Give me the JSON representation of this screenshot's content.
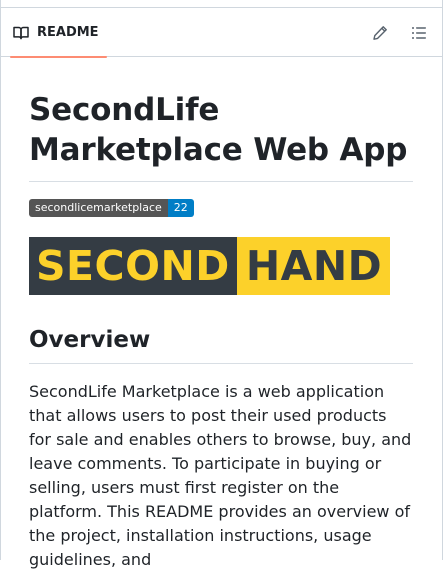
{
  "header": {
    "tab_label": "README",
    "tab_icon": "book-icon",
    "edit_icon": "pencil-icon",
    "outline_icon": "list-icon",
    "accent_color": "#fd8c73"
  },
  "readme": {
    "title": "SecondLife Marketplace Web App",
    "badge": {
      "label": "secondlicemarketplace",
      "value": "22",
      "label_color": "#555555",
      "value_color": "#007ec6"
    },
    "logo": {
      "left_text": "SECOND",
      "right_text": "HAND",
      "dark_color": "#343c44",
      "yellow_color": "#fcd12a"
    },
    "overview_heading": "Overview",
    "overview_text": "SecondLife Marketplace is a web application that allows users to post their used products for sale and enables others to browse, buy, and leave comments. To participate in buying or selling, users must first register on the platform. This README provides an overview of the project, installation instructions, usage guidelines, and"
  }
}
